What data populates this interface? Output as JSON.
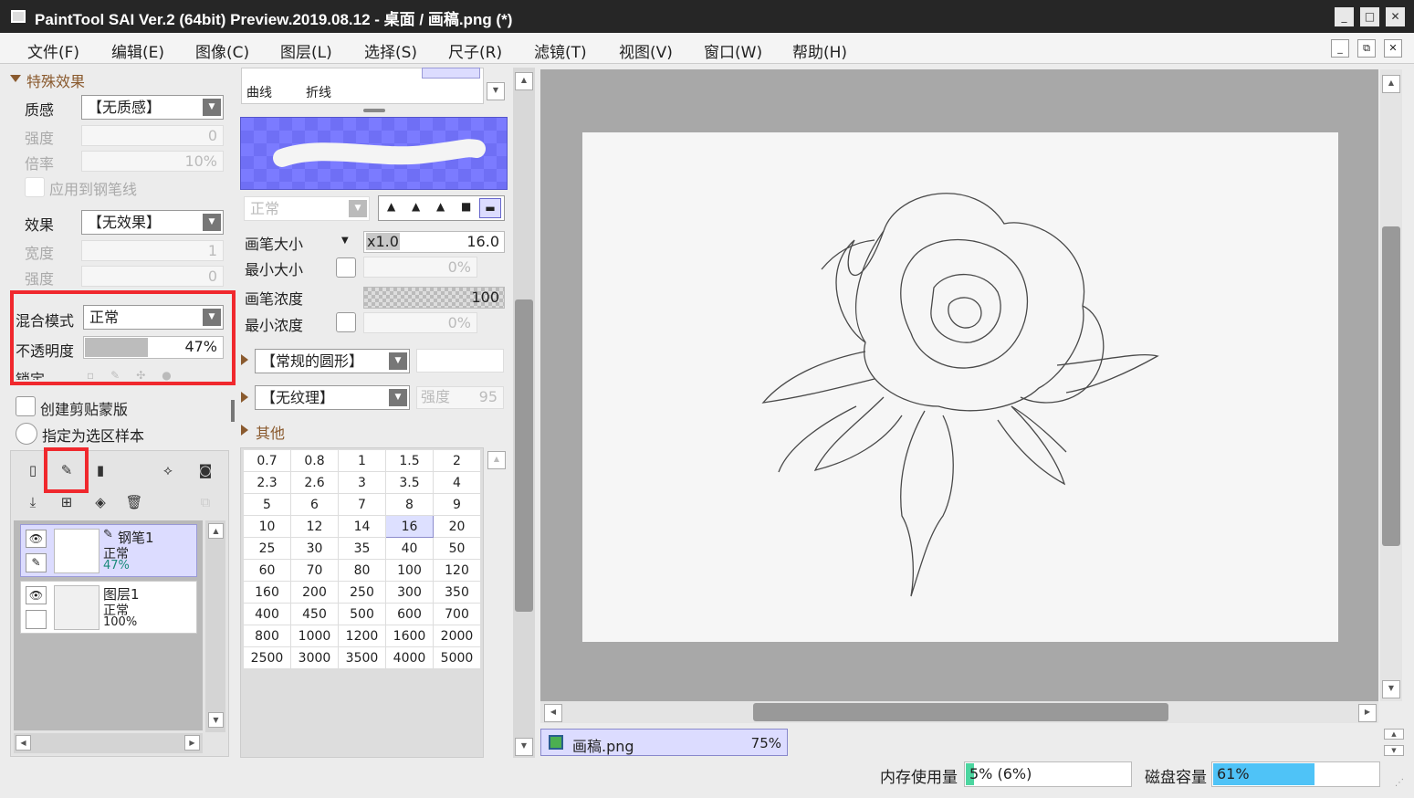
{
  "titlebar": {
    "title": "PaintTool SAI Ver.2 (64bit) Preview.2019.08.12 - 桌面 / 画稿.png (*)"
  },
  "menu": [
    {
      "label": "文件(F)"
    },
    {
      "label": "编辑(E)"
    },
    {
      "label": "图像(C)"
    },
    {
      "label": "图层(L)"
    },
    {
      "label": "选择(S)"
    },
    {
      "label": "尺子(R)"
    },
    {
      "label": "滤镜(T)"
    },
    {
      "label": "视图(V)"
    },
    {
      "label": "窗口(W)"
    },
    {
      "label": "帮助(H)"
    }
  ],
  "effects": {
    "section": "特殊效果",
    "texture_label": "质感",
    "texture_value": "【无质感】",
    "strength_label": "强度",
    "strength_value": "0",
    "scale_label": "倍率",
    "scale_value": "10%",
    "apply_pen": "应用到钢笔线",
    "effect_label": "效果",
    "effect_value": "【无效果】",
    "width_label": "宽度",
    "width_value": "1",
    "strength2_label": "强度",
    "strength2_value": "0"
  },
  "layer_props": {
    "blend_label": "混合模式",
    "blend_value": "正常",
    "opacity_label": "不透明度",
    "opacity_value": "47%",
    "opacity": 0.47,
    "lock_label": "锁定",
    "clip": "创建剪贴蒙版",
    "sample": "指定为选区样本"
  },
  "layers": [
    {
      "name": "钢笔1",
      "mode": "正常",
      "opacity": "47%"
    },
    {
      "name": "图层1",
      "mode": "正常",
      "opacity": "100%"
    }
  ],
  "tools": {
    "curve": "曲线",
    "polyline": "折线"
  },
  "brush": {
    "mode": "正常",
    "size_label": "画笔大小",
    "size_mult": "x1.0",
    "size_value": "16.0",
    "min_size_label": "最小大小",
    "min_size_value": "0%",
    "density_label": "画笔浓度",
    "density_value": "100",
    "min_density_label": "最小浓度",
    "min_density_value": "0%",
    "shape": "【常规的圆形】",
    "texture": "【无纹理】",
    "texture_strength_label": "强度",
    "texture_strength": "95",
    "other": "其他"
  },
  "sizes": [
    [
      "0.7",
      "0.8",
      "1",
      "1.5",
      "2"
    ],
    [
      "2.3",
      "2.6",
      "3",
      "3.5",
      "4"
    ],
    [
      "5",
      "6",
      "7",
      "8",
      "9"
    ],
    [
      "10",
      "12",
      "14",
      "16",
      "20"
    ],
    [
      "25",
      "30",
      "35",
      "40",
      "50"
    ],
    [
      "60",
      "70",
      "80",
      "100",
      "120"
    ],
    [
      "160",
      "200",
      "250",
      "300",
      "350"
    ],
    [
      "400",
      "450",
      "500",
      "600",
      "700"
    ],
    [
      "800",
      "1000",
      "1200",
      "1600",
      "2000"
    ],
    [
      "2500",
      "3000",
      "3500",
      "4000",
      "5000"
    ]
  ],
  "selected_size": "16",
  "document": {
    "name": "画稿.png",
    "zoom": "75%"
  },
  "status": {
    "mem_label": "内存使用量",
    "mem_value": "5% (6%)",
    "mem_fraction": 0.05,
    "disk_label": "磁盘容量",
    "disk_value": "61%",
    "disk_fraction": 0.61
  },
  "colors": {
    "accent": "#f0282d",
    "selected": "#dde0ff",
    "disk_bar": "#4fc3f7",
    "mem_bar": "#4cd6a0"
  }
}
